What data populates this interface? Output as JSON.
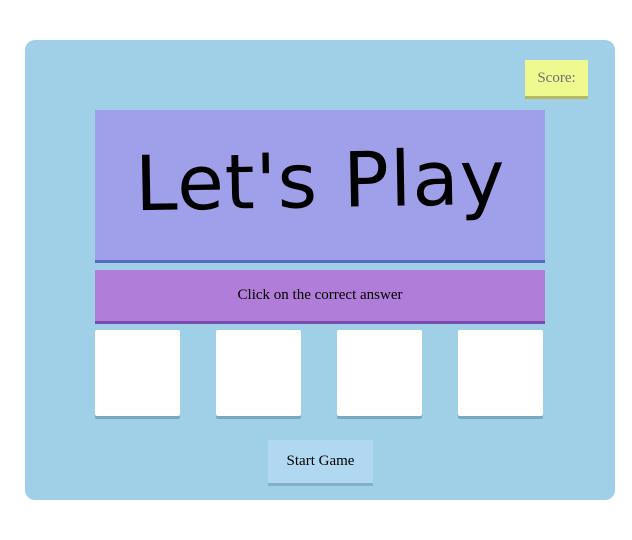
{
  "score": {
    "label": "Score:"
  },
  "title": {
    "text": "Let's Play"
  },
  "instruction": {
    "text": "Click on the correct answer"
  },
  "choices": [
    {
      "label": ""
    },
    {
      "label": ""
    },
    {
      "label": ""
    },
    {
      "label": ""
    }
  ],
  "start_button": {
    "label": "Start Game"
  },
  "colors": {
    "background": "#a0d0e8",
    "score_box": "#f0f890",
    "title_panel": "#a0a0ea",
    "instruction_bar": "#b07ed8",
    "choice_box": "#ffffff",
    "start_button": "#b0d8f0"
  }
}
